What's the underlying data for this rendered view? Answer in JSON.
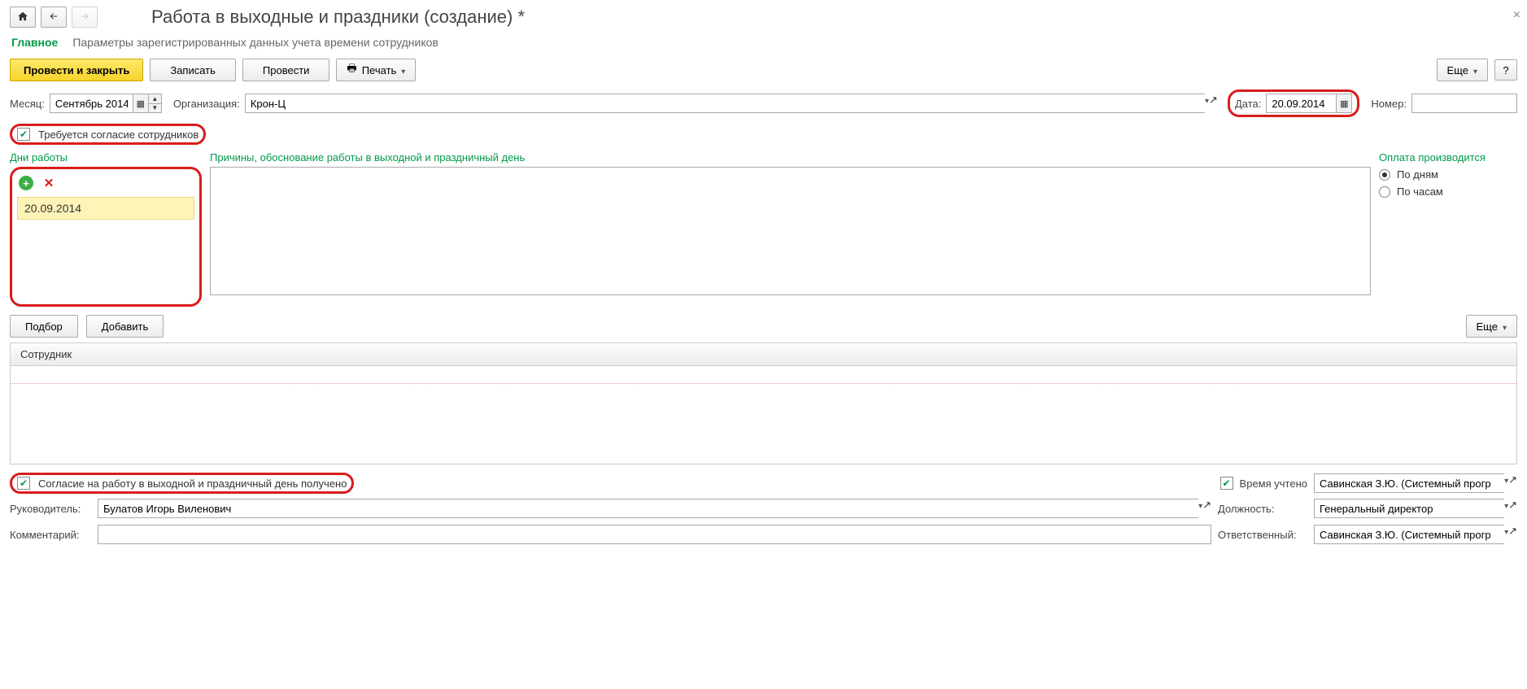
{
  "title": "Работа в выходные и праздники (создание) *",
  "tabs": {
    "main": "Главное",
    "params": "Параметры зарегистрированных данных учета времени сотрудников"
  },
  "actions": {
    "post_close": "Провести и закрыть",
    "save": "Записать",
    "post": "Провести",
    "print": "Печать",
    "more": "Еще",
    "help": "?"
  },
  "form": {
    "month_label": "Месяц:",
    "month_value": "Сентябрь 2014",
    "org_label": "Организация:",
    "org_value": "Крон-Ц",
    "date_label": "Дата:",
    "date_value": "20.09.2014",
    "number_label": "Номер:",
    "number_value": ""
  },
  "consent": {
    "required_label": "Требуется согласие сотрудников",
    "received_label": "Согласие на работу в выходной и праздничный день получено"
  },
  "days": {
    "title": "Дни работы",
    "items": [
      "20.09.2014"
    ]
  },
  "reasons": {
    "title": "Причины, обоснование работы в выходной и праздничный день",
    "value": ""
  },
  "payment": {
    "title": "Оплата производится",
    "by_days": "По дням",
    "by_hours": "По часам"
  },
  "employees": {
    "pick": "Подбор",
    "add": "Добавить",
    "col_employee": "Сотрудник"
  },
  "footer": {
    "time_counted": "Время учтено",
    "time_person": "Савинская З.Ю. (Системный прогр",
    "manager_label": "Руководитель:",
    "manager_value": "Булатов Игорь Виленович",
    "position_label": "Должность:",
    "position_value": "Генеральный директор",
    "comment_label": "Комментарий:",
    "comment_value": "",
    "responsible_label": "Ответственный:",
    "responsible_value": "Савинская З.Ю. (Системный прогр"
  }
}
